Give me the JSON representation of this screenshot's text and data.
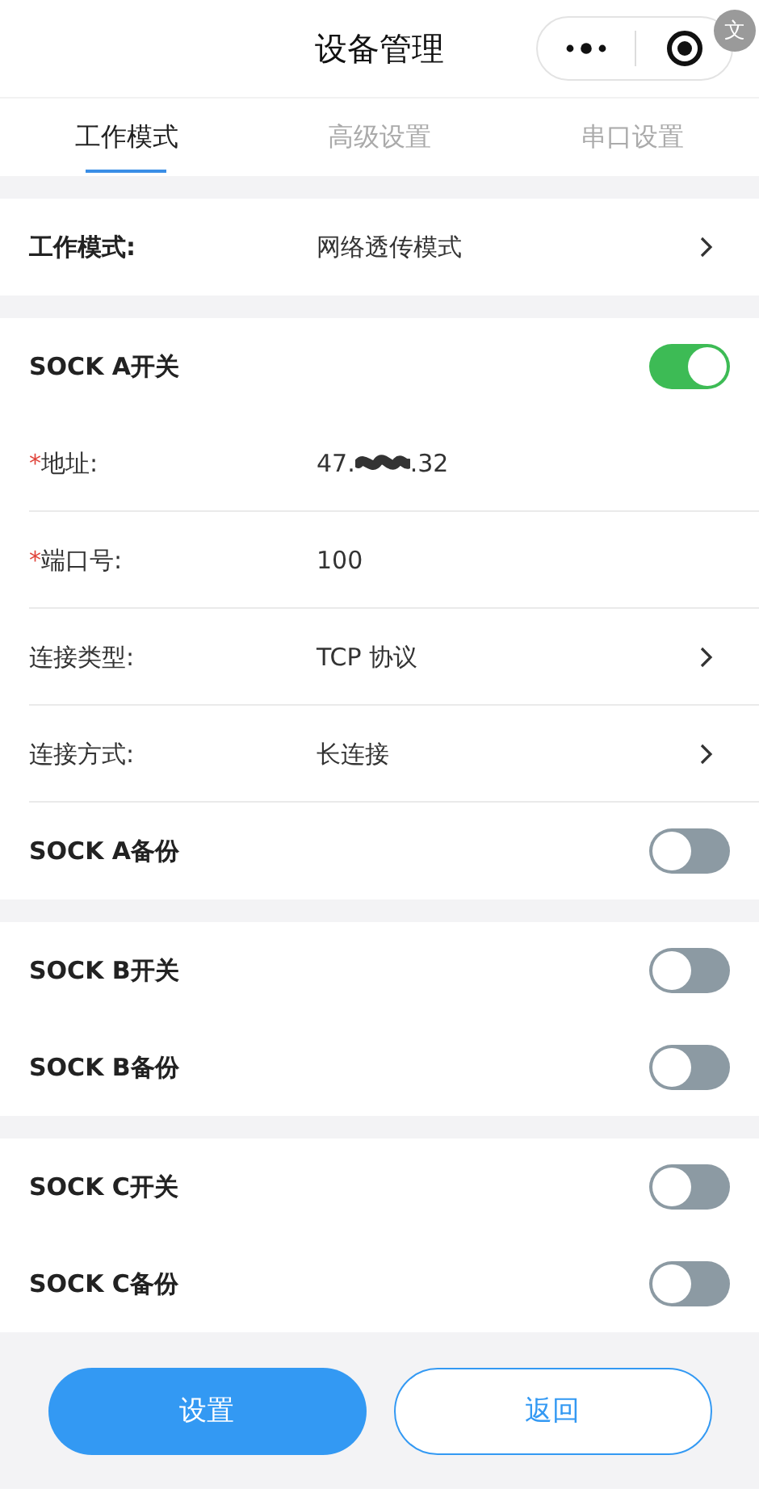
{
  "nav": {
    "title": "设备管理",
    "translate_badge": "文"
  },
  "tabs": [
    {
      "label": "工作模式",
      "selected": true
    },
    {
      "label": "高级设置",
      "selected": false
    },
    {
      "label": "串口设置",
      "selected": false
    }
  ],
  "sections": [
    {
      "rows": [
        {
          "kind": "select",
          "label": "工作模式:",
          "bold": true,
          "value": "网络透传模式"
        }
      ]
    },
    {
      "rows": [
        {
          "kind": "toggle",
          "label": "SOCK A开关",
          "bold": true,
          "on": true
        },
        {
          "kind": "redacted",
          "label": "地址:",
          "required_mark": "*",
          "value_start": "47.",
          "value_end": ".32"
        },
        {
          "kind": "text",
          "label": "端口号:",
          "required_mark": "*",
          "value": "100"
        },
        {
          "kind": "select",
          "label": "连接类型:",
          "value": "TCP 协议"
        },
        {
          "kind": "select",
          "label": "连接方式:",
          "value": "长连接"
        },
        {
          "kind": "toggle",
          "label": "SOCK A备份",
          "bold": true,
          "on": false
        }
      ]
    },
    {
      "rows": [
        {
          "kind": "toggle",
          "label": "SOCK B开关",
          "bold": true,
          "on": false
        },
        {
          "kind": "toggle",
          "label": "SOCK B备份",
          "bold": true,
          "on": false
        }
      ]
    },
    {
      "rows": [
        {
          "kind": "toggle",
          "label": "SOCK C开关",
          "bold": true,
          "on": false
        },
        {
          "kind": "toggle",
          "label": "SOCK C备份",
          "bold": true,
          "on": false
        }
      ]
    }
  ],
  "buttons": [
    {
      "label": "设置",
      "kind": "primary"
    },
    {
      "label": "返回",
      "kind": "outline"
    }
  ]
}
